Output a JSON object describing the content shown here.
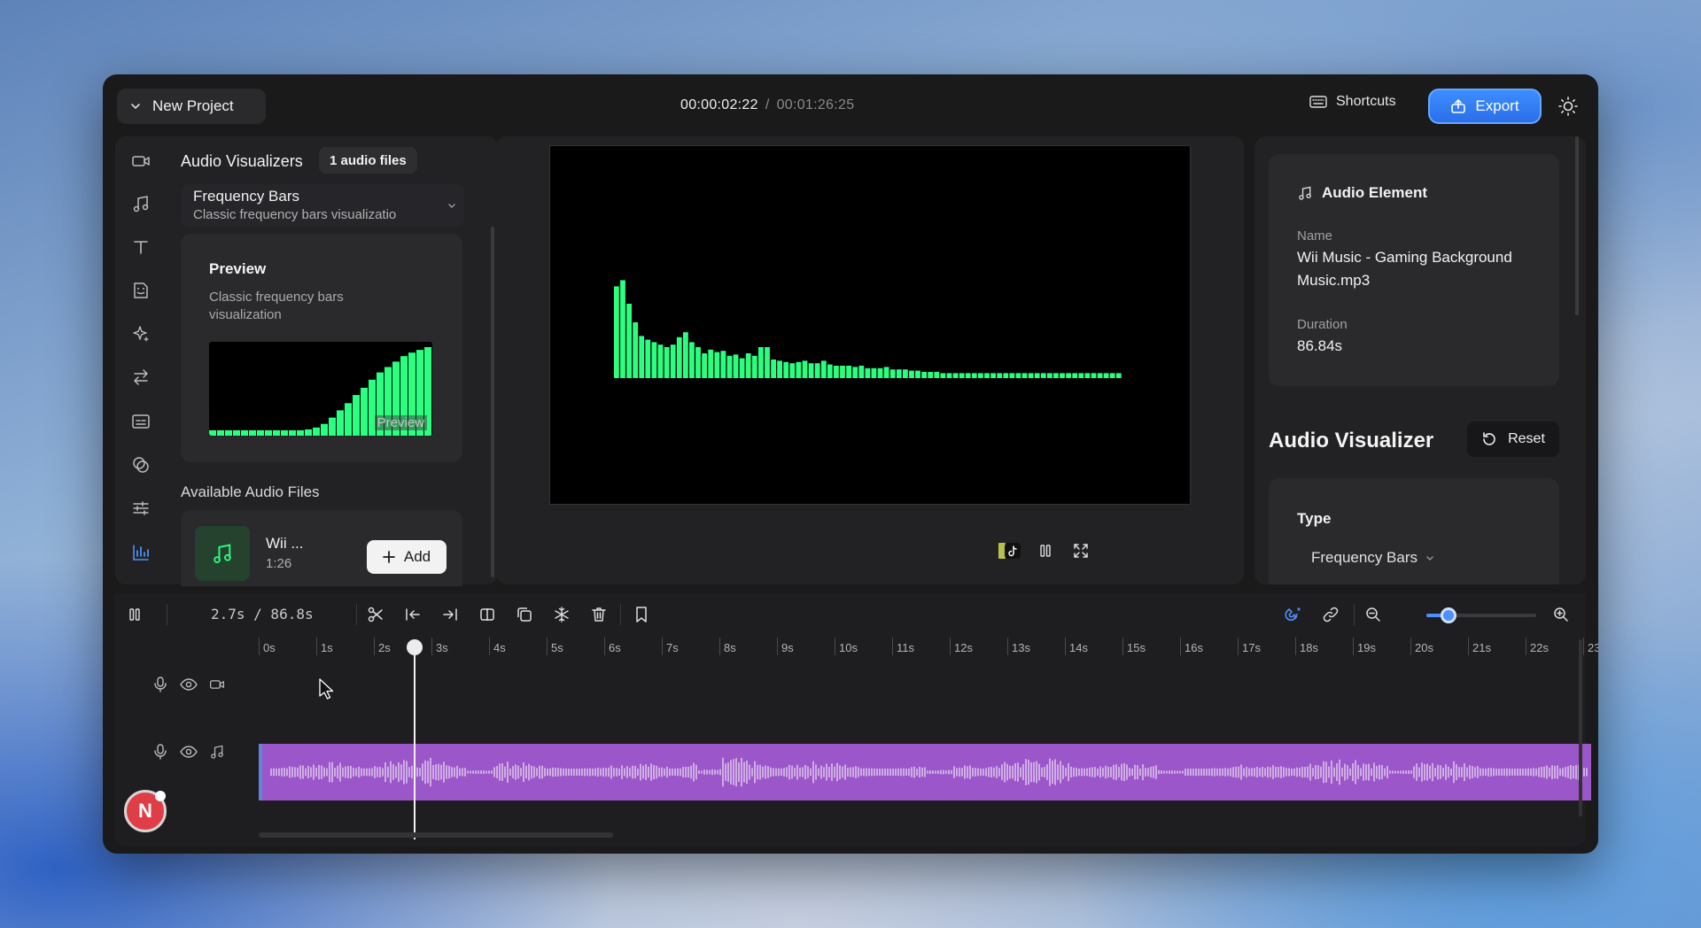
{
  "header": {
    "project_label": "New Project",
    "current_time": "00:00:02:22",
    "separator": "/",
    "total_time": "00:01:26:25",
    "shortcuts_label": "Shortcuts",
    "export_label": "Export"
  },
  "tools": [
    "video-icon",
    "music-icon",
    "text-icon",
    "sticker-icon",
    "effects-icon",
    "transitions-icon",
    "captions-icon",
    "shapes-icon",
    "adjust-icon",
    "visualizer-icon"
  ],
  "left_panel": {
    "title": "Audio Visualizers",
    "badge": "1 audio files",
    "visualizer_select": {
      "name": "Frequency Bars",
      "description": "Classic frequency bars visualizatio"
    },
    "preview": {
      "heading": "Preview",
      "description": "Classic frequency bars visualization",
      "overlay_label": "Preview",
      "bar_levels": [
        0.06,
        0.06,
        0.06,
        0.06,
        0.06,
        0.06,
        0.06,
        0.06,
        0.06,
        0.06,
        0.06,
        0.06,
        0.07,
        0.09,
        0.13,
        0.2,
        0.28,
        0.36,
        0.45,
        0.53,
        0.62,
        0.7,
        0.76,
        0.82,
        0.88,
        0.92,
        0.95,
        0.98
      ]
    },
    "available_title": "Available Audio Files",
    "audio_file": {
      "name": "Wii ...",
      "duration": "1:26",
      "add_label": "Add"
    }
  },
  "stage": {
    "bar_levels": [
      0.74,
      0.79,
      0.6,
      0.45,
      0.34,
      0.31,
      0.29,
      0.27,
      0.25,
      0.27,
      0.33,
      0.37,
      0.29,
      0.25,
      0.2,
      0.23,
      0.21,
      0.22,
      0.18,
      0.19,
      0.16,
      0.2,
      0.18,
      0.25,
      0.25,
      0.15,
      0.14,
      0.13,
      0.12,
      0.13,
      0.14,
      0.12,
      0.12,
      0.14,
      0.11,
      0.1,
      0.1,
      0.1,
      0.09,
      0.1,
      0.08,
      0.08,
      0.08,
      0.09,
      0.07,
      0.07,
      0.07,
      0.06,
      0.06,
      0.05,
      0.05,
      0.05,
      0.04,
      0.04,
      0.04,
      0.04,
      0.04,
      0.04,
      0.04,
      0.04,
      0.04,
      0.04,
      0.04,
      0.04,
      0.04,
      0.04,
      0.04,
      0.04,
      0.04,
      0.04,
      0.04,
      0.04,
      0.04,
      0.04,
      0.04,
      0.04,
      0.04,
      0.04,
      0.04,
      0.04,
      0.04
    ]
  },
  "right_panel": {
    "element_title": "Audio Element",
    "name_label": "Name",
    "name_value": "Wii Music - Gaming Background Music.mp3",
    "duration_label": "Duration",
    "duration_value": "86.84s",
    "visualizer_title": "Audio Visualizer",
    "reset_label": "Reset",
    "type_label": "Type",
    "type_value": "Frequency Bars"
  },
  "timeline": {
    "time_readout": "2.7s / 86.8s",
    "ruler_labels": [
      "0s",
      "1s",
      "2s",
      "3s",
      "4s",
      "5s",
      "6s",
      "7s",
      "8s",
      "9s",
      "10s",
      "11s",
      "12s",
      "13s",
      "14s",
      "15s",
      "16s",
      "17s",
      "18s",
      "19s",
      "20s",
      "21s",
      "22s",
      "23"
    ],
    "playhead_seconds": 2.7,
    "zoom_level": 0.2
  },
  "user": {
    "initial": "N"
  },
  "colors": {
    "accent": "#3d8dff",
    "visualizer_green": "#2bff7f",
    "audio_clip": "#9b56c9"
  }
}
